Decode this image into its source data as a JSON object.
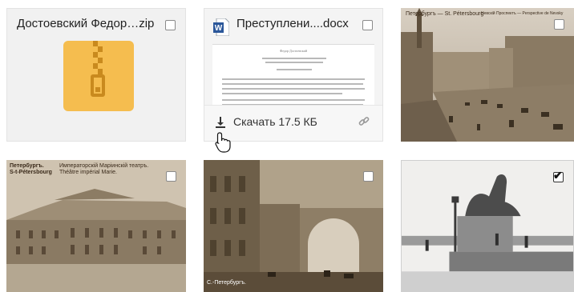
{
  "files": [
    {
      "title": "Достоевский Федор…zip",
      "kind": "zip-archive",
      "selected": false
    },
    {
      "title": "Преступлени....docx",
      "kind": "word-document",
      "selected": false,
      "doc_author": "Федор Достоевский",
      "download_label": "Скачать 17.5 КБ"
    },
    {
      "kind": "photo",
      "selected": false,
      "caption_left": "Петербургъ — St. Pétersbourg",
      "caption_right": "Невскій Проспектъ — Perspective de Nevsky"
    },
    {
      "kind": "photo",
      "selected": false,
      "caption_city_ru": "Петербургъ.",
      "caption_city_fr": "S-t-Pétersbourg",
      "caption_title_ru": "Императорскій Маріинскій театръ.",
      "caption_title_fr": "Théâtre impérial Marie."
    },
    {
      "kind": "photo",
      "selected": false,
      "caption": "С.-Петербургъ."
    },
    {
      "kind": "photo",
      "selected": true
    }
  ],
  "icons": {
    "zip": "zip-archive-icon",
    "word": "word-doc-icon",
    "download": "download-icon",
    "link": "link-icon",
    "cursor": "hand-pointer-icon"
  },
  "colors": {
    "zip_icon": "#f5bd4f",
    "zip_zipper": "#c98a1e",
    "word_blue": "#2b579a",
    "sepia": "#6e5a40"
  }
}
